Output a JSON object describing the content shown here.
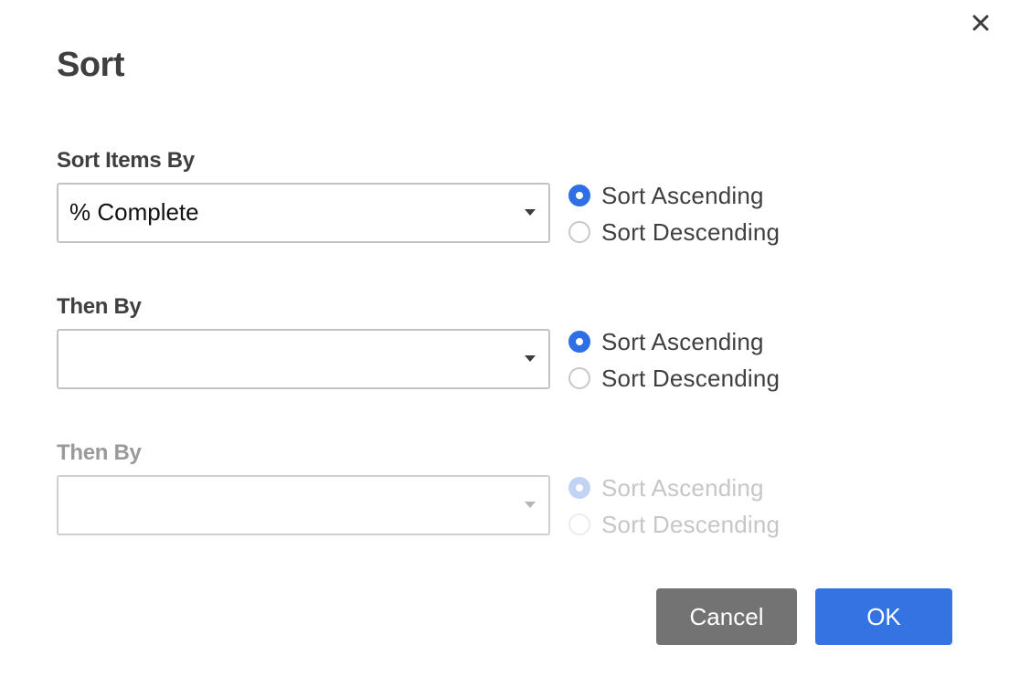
{
  "dialog": {
    "title": "Sort",
    "close_icon": "close-icon"
  },
  "sections": [
    {
      "label": "Sort Items By",
      "selected_value": "% Complete",
      "enabled": true,
      "options": [
        {
          "label": "Sort Ascending",
          "checked": true
        },
        {
          "label": "Sort Descending",
          "checked": false
        }
      ]
    },
    {
      "label": "Then By",
      "selected_value": "",
      "enabled": true,
      "options": [
        {
          "label": "Sort Ascending",
          "checked": true
        },
        {
          "label": "Sort Descending",
          "checked": false
        }
      ]
    },
    {
      "label": "Then By",
      "selected_value": "",
      "enabled": false,
      "options": [
        {
          "label": "Sort Ascending",
          "checked": true
        },
        {
          "label": "Sort Descending",
          "checked": false
        }
      ]
    }
  ],
  "buttons": {
    "cancel_label": "Cancel",
    "ok_label": "OK"
  },
  "colors": {
    "accent": "#3374e2",
    "cancel": "#737373"
  }
}
